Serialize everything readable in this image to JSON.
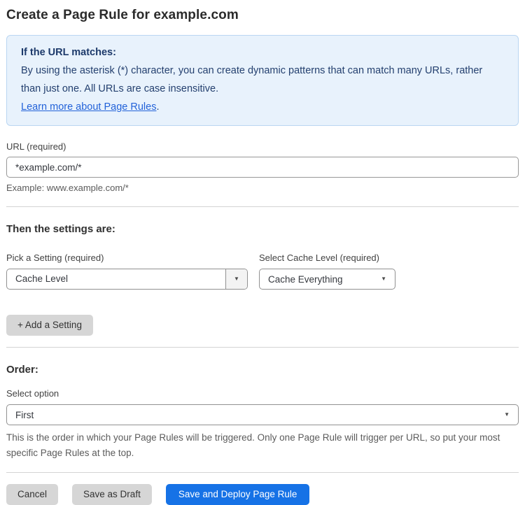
{
  "page": {
    "title": "Create a Page Rule for example.com"
  },
  "info_box": {
    "heading": "If the URL matches:",
    "body": "By using the asterisk (*) character, you can create dynamic patterns that can match many URLs, rather than just one. All URLs are case insensitive.",
    "link_label": "Learn more about Page Rules",
    "link_suffix": "."
  },
  "url_field": {
    "label": "URL (required)",
    "value": "*example.com/*",
    "helper": "Example: www.example.com/*"
  },
  "settings": {
    "heading": "Then the settings are:",
    "setting_label": "Pick a Setting (required)",
    "setting_value": "Cache Level",
    "cache_label": "Select Cache Level (required)",
    "cache_value": "Cache Everything",
    "add_button_label": "+ Add a Setting"
  },
  "order": {
    "heading": "Order:",
    "label": "Select option",
    "value": "First",
    "helper": "This is the order in which your Page Rules will be triggered. Only one Page Rule will trigger per URL, so put your most specific Page Rules at the top."
  },
  "actions": {
    "cancel_label": "Cancel",
    "save_draft_label": "Save as Draft",
    "save_deploy_label": "Save and Deploy Page Rule"
  },
  "icons": {
    "caret_down": "▼"
  },
  "colors": {
    "info_bg": "#e8f2fc",
    "info_border": "#bad6f2",
    "info_text": "#24406f",
    "link": "#2262d9",
    "primary_button": "#1672e6",
    "secondary_button": "#d6d6d6"
  }
}
